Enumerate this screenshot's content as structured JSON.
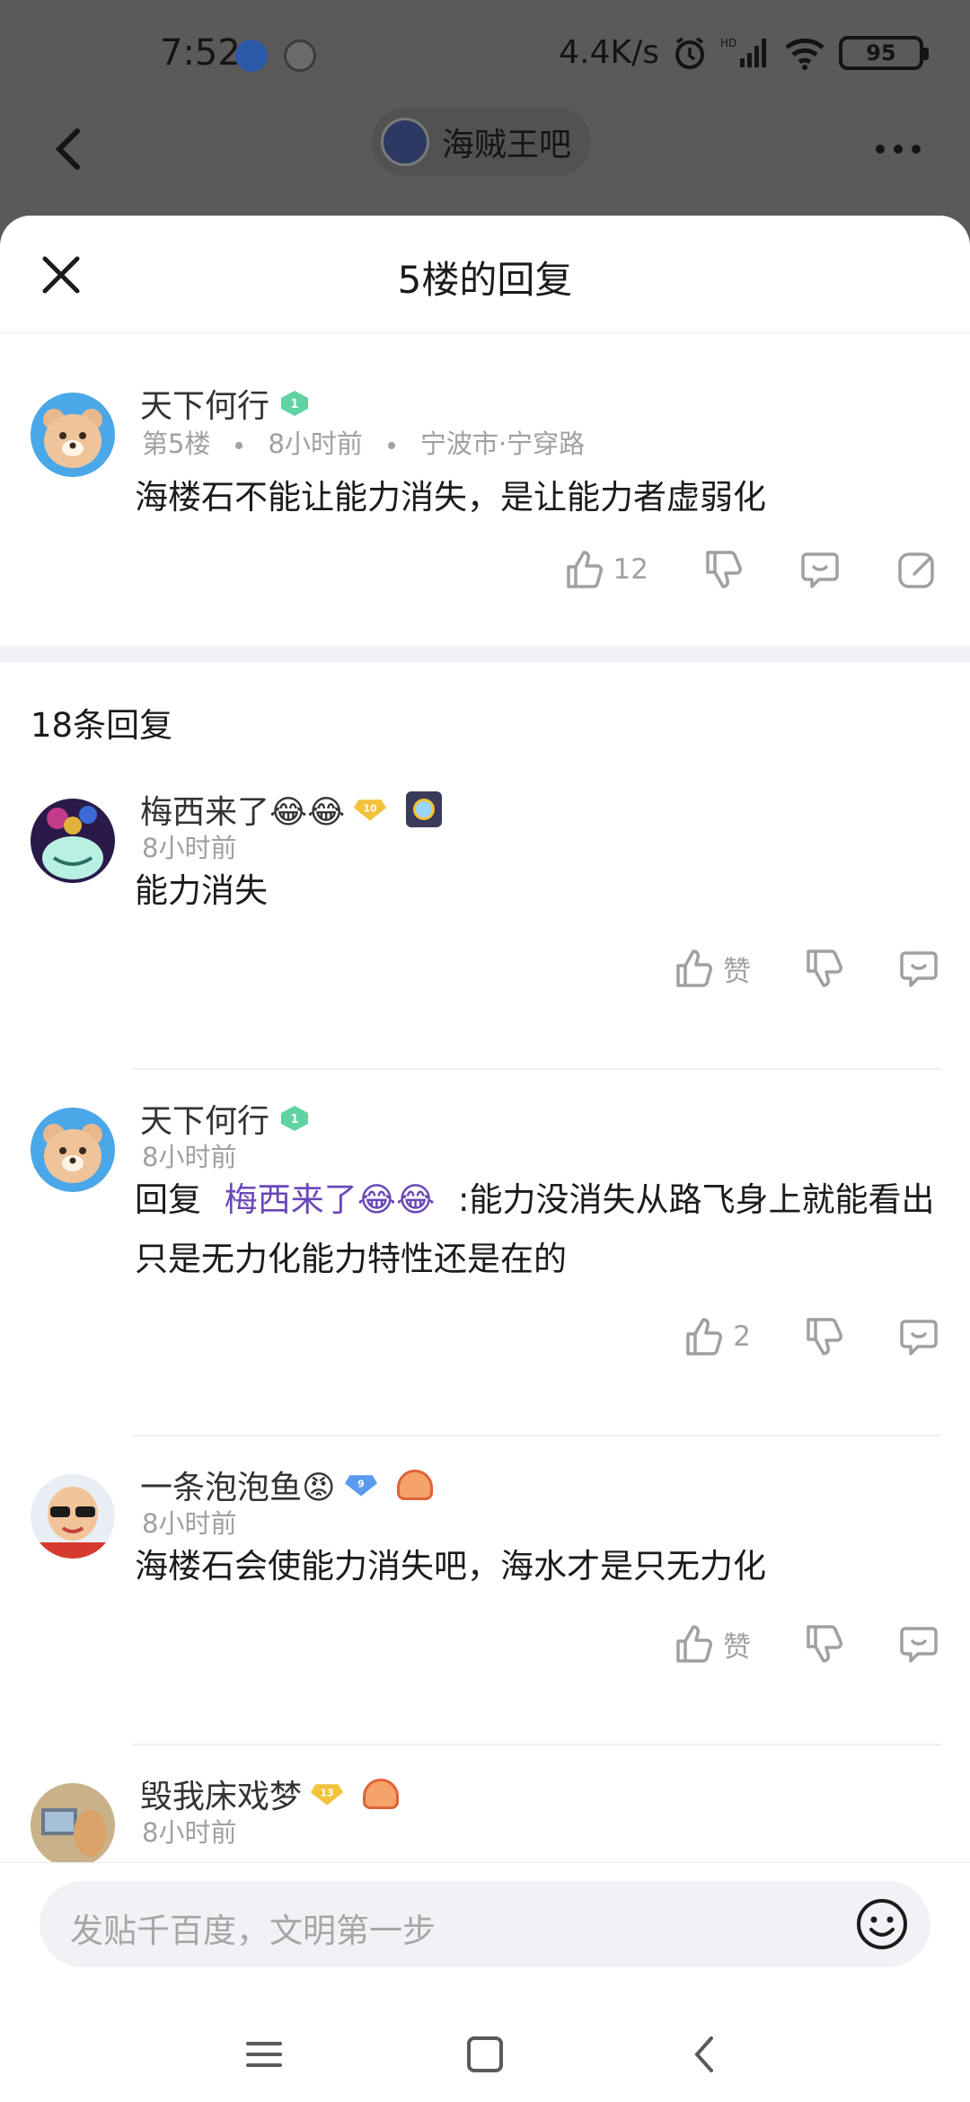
{
  "status_bar": {
    "time": "7:52",
    "net_speed": "4.4K/s",
    "battery": "95"
  },
  "topbar": {
    "forum_name": "海贼王吧"
  },
  "sheet": {
    "title": "5楼的回复"
  },
  "main_post": {
    "username": "天下何行",
    "level": "1",
    "floor": "第5楼",
    "time": "8小时前",
    "location": "宁波市·宁穿路",
    "content": "海楼石不能让能力消失，是让能力者虚弱化",
    "like_count": "12"
  },
  "replies_count": "18条回复",
  "replies": [
    {
      "username": "梅西来了😂😂",
      "level": "10",
      "time": "8小时前",
      "content": "能力消失",
      "like_label": "赞"
    },
    {
      "username": "天下何行",
      "level": "1",
      "time": "8小时前",
      "reply_prefix": "回复",
      "mention": "梅西来了😂😂",
      "content": ":能力没消失从路飞身上就能看出只是无力化能力特性还是在的",
      "like_label": "2"
    },
    {
      "username": "一条泡泡鱼😡",
      "level": "9",
      "time": "8小时前",
      "content": "海楼石会使能力消失吧，海水才是只无力化",
      "like_label": "赞"
    },
    {
      "username": "毁我床戏梦",
      "level": "13",
      "time": "8小时前"
    }
  ],
  "input": {
    "placeholder": "发贴千百度，文明第一步"
  },
  "colors": {
    "accent": "#6a47b8",
    "muted": "#a0a0a0",
    "badge_green": "#5fd3a2",
    "badge_gold": "#f2c23b",
    "badge_blue": "#5a9bf0"
  }
}
